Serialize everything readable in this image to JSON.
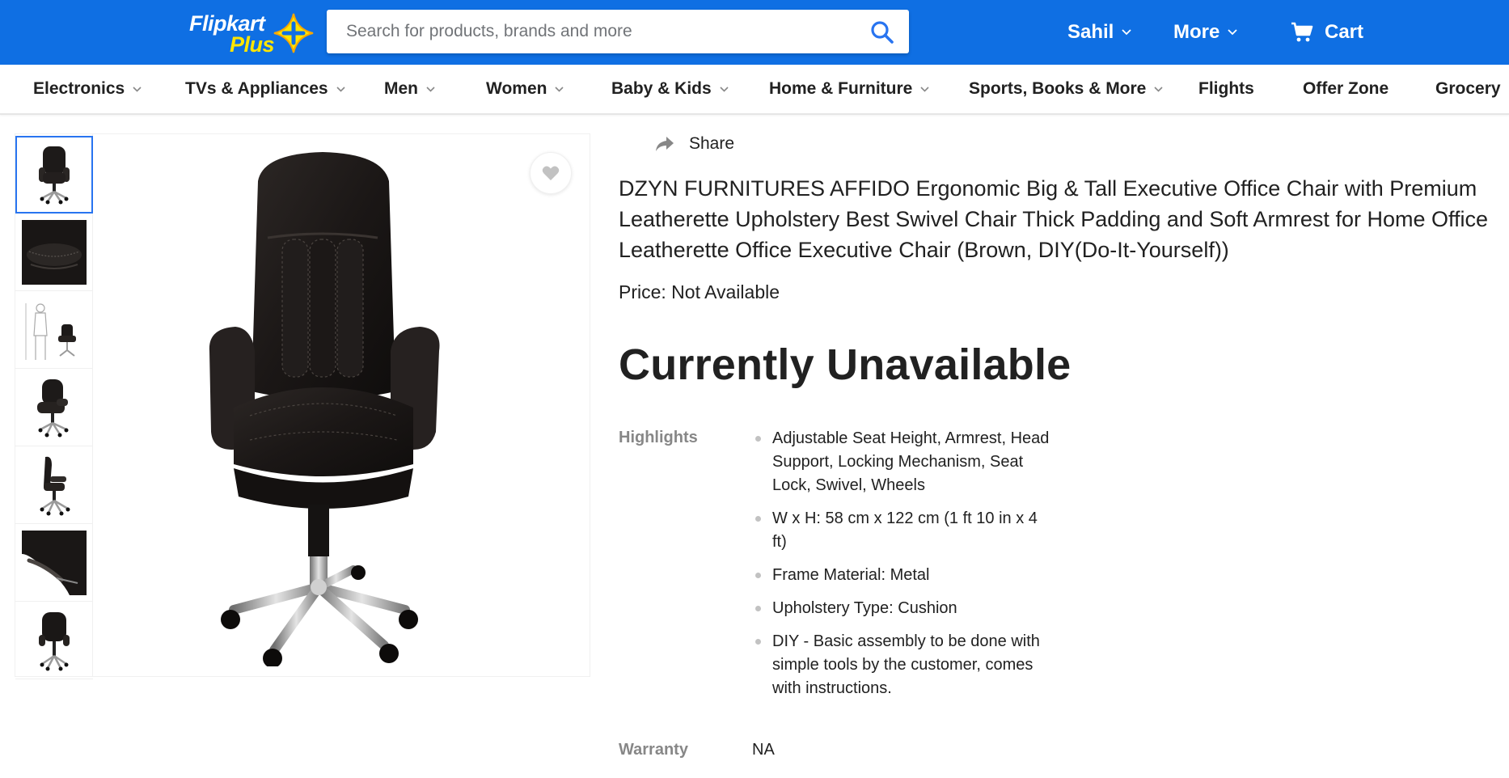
{
  "header": {
    "logo_text_top": "Flipkart",
    "logo_text_bottom": "Plus",
    "search_placeholder": "Search for products, brands and more",
    "user_label": "Sahil",
    "more_label": "More",
    "cart_label": "Cart",
    "brand_color": "#0f6fe3",
    "logo_accent": "#ffe500"
  },
  "categories": [
    {
      "label": "Electronics",
      "has_dropdown": true
    },
    {
      "label": "TVs & Appliances",
      "has_dropdown": true
    },
    {
      "label": "Men",
      "has_dropdown": true
    },
    {
      "label": "Women",
      "has_dropdown": true
    },
    {
      "label": "Baby & Kids",
      "has_dropdown": true
    },
    {
      "label": "Home & Furniture",
      "has_dropdown": true
    },
    {
      "label": "Sports, Books & More",
      "has_dropdown": true
    },
    {
      "label": "Flights",
      "has_dropdown": false
    },
    {
      "label": "Offer Zone",
      "has_dropdown": false
    },
    {
      "label": "Grocery",
      "has_dropdown": false
    }
  ],
  "gallery": {
    "thumbnails": [
      "chair-front",
      "seat-closeup",
      "size-chart",
      "chair-angle",
      "chair-side",
      "armrest-closeup",
      "chair-back"
    ],
    "selected_index": 0
  },
  "product": {
    "share_label": "Share",
    "title": "DZYN FURNITURES AFFIDO Ergonomic Big & Tall Executive Office Chair with Premium Leatherette Upholstery Best Swivel Chair Thick Padding and Soft Armrest for Home Office Leatherette Office Executive Chair  (Brown, DIY(Do-It-Yourself))",
    "price_text": "Price: Not Available",
    "availability": "Currently Unavailable",
    "highlights_label": "Highlights",
    "highlights": [
      "Adjustable Seat Height, Armrest, Head Support, Locking Mechanism, Seat Lock, Swivel, Wheels",
      "W x H: 58 cm x 122 cm (1 ft 10 in x 4 ft)",
      "Frame Material: Metal",
      "Upholstery Type: Cushion",
      "DIY - Basic assembly to be done with simple tools by the customer, comes with instructions."
    ],
    "warranty_label": "Warranty",
    "warranty_value": "NA"
  }
}
